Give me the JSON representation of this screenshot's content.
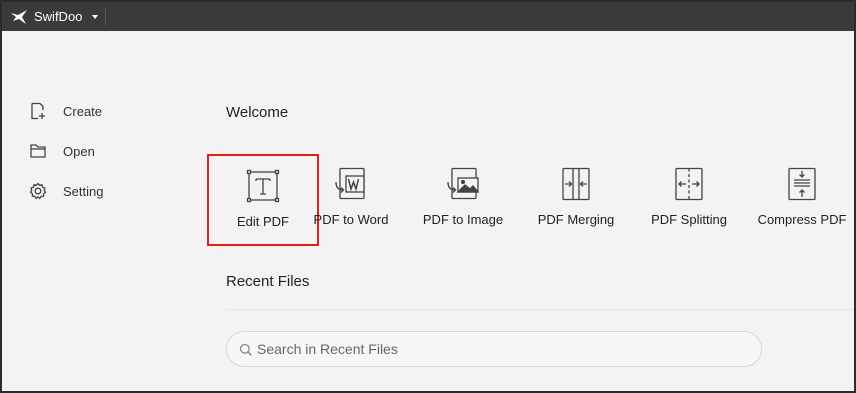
{
  "titlebar": {
    "app_name": "SwifDoo",
    "logo_icon": "swift-bird-icon",
    "menu_icon": "caret-down-icon"
  },
  "sidebar": {
    "items": [
      {
        "label": "Create",
        "icon": "new-document-icon"
      },
      {
        "label": "Open",
        "icon": "folder-icon"
      },
      {
        "label": "Setting",
        "icon": "gear-icon"
      }
    ]
  },
  "main": {
    "welcome_title": "Welcome",
    "tools": [
      {
        "label": "Edit PDF",
        "icon": "text-box-icon",
        "highlighted": true
      },
      {
        "label": "PDF to Word",
        "icon": "word-convert-icon"
      },
      {
        "label": "PDF to Image",
        "icon": "image-convert-icon"
      },
      {
        "label": "PDF Merging",
        "icon": "merge-icon"
      },
      {
        "label": "PDF Splitting",
        "icon": "split-icon"
      },
      {
        "label": "Compress PDF",
        "icon": "compress-icon"
      }
    ],
    "recent_title": "Recent Files",
    "search": {
      "placeholder": "Search in Recent Files",
      "value": ""
    }
  },
  "colors": {
    "titlebar": "#3a3a3a",
    "highlight_border": "#e02020",
    "background": "#f3f3f3"
  }
}
